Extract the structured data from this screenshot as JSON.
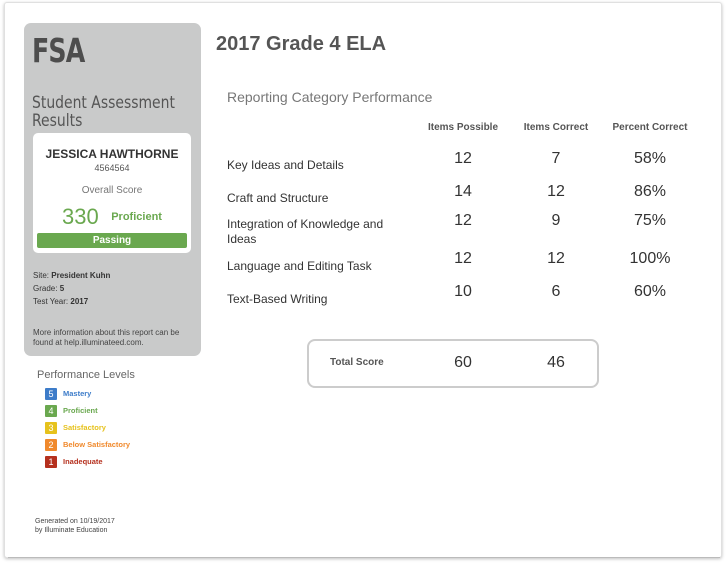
{
  "brand": {
    "logo": "FSA",
    "subtitle_line1": "Student Assessment",
    "subtitle_line2": "Results"
  },
  "student": {
    "name": "JESSICA HAWTHORNE",
    "id": "4564564",
    "overall_label": "Overall Score",
    "score": "330",
    "level": "Proficient",
    "status": "Passing",
    "site_label": "Site:",
    "site": "President Kuhn",
    "grade_label": "Grade:",
    "grade": "5",
    "year_label": "Test Year:",
    "year": "2017",
    "more_info": "More information about this report can be found at help.illuminateed.com."
  },
  "legend": {
    "title": "Performance Levels",
    "items": [
      {
        "num": "5",
        "label": "Mastery",
        "color": "#3d7cc9"
      },
      {
        "num": "4",
        "label": "Proficient",
        "color": "#6aa84f"
      },
      {
        "num": "3",
        "label": "Satisfactory",
        "color": "#e6c21c"
      },
      {
        "num": "2",
        "label": "Below Satisfactory",
        "color": "#f0892c"
      },
      {
        "num": "1",
        "label": "Inadequate",
        "color": "#b5301e"
      }
    ]
  },
  "footer": {
    "generated_line1": "Generated on 10/19/2017",
    "generated_line2": "by Illuminate Education"
  },
  "report": {
    "title": "2017 Grade 4 ELA",
    "section_title": "Reporting Category Performance",
    "columns": [
      "Items Possible",
      "Items Correct",
      "Percent Correct"
    ],
    "rows": [
      {
        "label": "Key Ideas and Details",
        "possible": "12",
        "correct": "7",
        "percent": "58%"
      },
      {
        "label": "Craft and Structure",
        "possible": "14",
        "correct": "12",
        "percent": "86%"
      },
      {
        "label": "Integration of Knowledge and Ideas",
        "possible": "12",
        "correct": "9",
        "percent": "75%"
      },
      {
        "label": "Language and Editing Task",
        "possible": "12",
        "correct": "12",
        "percent": "100%"
      },
      {
        "label": "Text-Based Writing",
        "possible": "10",
        "correct": "6",
        "percent": "60%"
      }
    ],
    "total": {
      "label": "Total Score",
      "possible": "60",
      "correct": "46"
    }
  }
}
